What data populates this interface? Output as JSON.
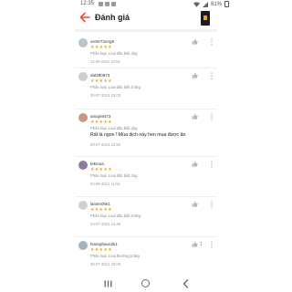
{
  "status_bar": {
    "time": "12:35",
    "battery": "81%"
  },
  "header": {
    "title": "Đánh giá"
  },
  "reviews": [
    {
      "user": "vsmtr72eng8",
      "variation": "Phân loại: Loai đặc biệt,1kg",
      "text": "",
      "date": "11-08-2021 10:01",
      "likes": ""
    },
    {
      "user": "dat280973",
      "variation": "Phân loại: Loai đặc biệt,0.5kg",
      "text": "",
      "date": "30-07-2021 15:03",
      "likes": ""
    },
    {
      "user": "amajn9473",
      "variation": "Phân loại: Loai đặc biệt,1kg",
      "text": "Rất là ngon ! Mùa dịch này hen mua được ăn",
      "date": "29-07-2021 12:50",
      "likes": ""
    },
    {
      "user": "tekmoa",
      "variation": "Phân loại: Loai đặc biệt,1kg",
      "text": "",
      "date": "02-08-2021 11:52",
      "likes": ""
    },
    {
      "user": "lanxtn0hk1",
      "variation": "Phân loại: Loai đặc biệt,0.5kg",
      "text": "",
      "date": "24-07-2021 14:49",
      "likes": ""
    },
    {
      "user": "hoanghauu2k1",
      "variation": "Phân loại: Loai thường,0.5kg",
      "text": "",
      "date": "30-07-2021 20:08",
      "likes": "1"
    }
  ],
  "stars_glyph": "★★★★★",
  "accent_color": "#ee4d2d",
  "star_color": "#f5a623"
}
